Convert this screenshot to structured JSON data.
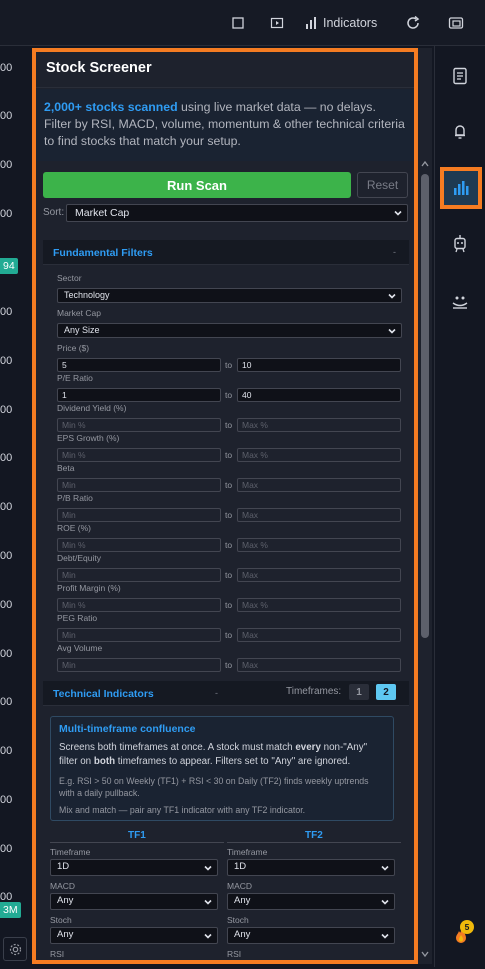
{
  "topbar": {
    "indicators_label": "Indicators"
  },
  "chart_strip": {
    "ticks": [
      "00",
      "00",
      "00",
      "00",
      "00",
      "00",
      "00",
      "00",
      "00",
      "00",
      "00",
      "00",
      "00",
      "00",
      "00",
      "00",
      "00",
      "00",
      "00"
    ],
    "badge_top": "94",
    "badge_bottom": "3M"
  },
  "screener": {
    "title": "Stock Screener",
    "intro_highlight": "2,000+ stocks scanned",
    "intro_rest": " using live market data — no delays. Filter by RSI, MACD, volume, momentum & other technical criteria to find stocks that match your setup.",
    "run_label": "Run Scan",
    "reset_label": "Reset",
    "sort_label": "Sort:",
    "sort_value": "Market Cap",
    "fundamental": {
      "title": "Fundamental Filters",
      "caret": "-",
      "sector_label": "Sector",
      "sector_value": "Technology",
      "mcap_label": "Market Cap",
      "mcap_value": "Any Size",
      "to_label": "to",
      "ranges": [
        {
          "label": "Price ($)",
          "min": "5",
          "max": "10",
          "min_ph": "",
          "max_ph": ""
        },
        {
          "label": "P/E Ratio",
          "min": "1",
          "max": "40",
          "min_ph": "",
          "max_ph": ""
        },
        {
          "label": "Dividend Yield (%)",
          "min": "",
          "max": "",
          "min_ph": "Min %",
          "max_ph": "Max %"
        },
        {
          "label": "EPS Growth (%)",
          "min": "",
          "max": "",
          "min_ph": "Min %",
          "max_ph": "Max %"
        },
        {
          "label": "Beta",
          "min": "",
          "max": "",
          "min_ph": "Min",
          "max_ph": "Max"
        },
        {
          "label": "P/B Ratio",
          "min": "",
          "max": "",
          "min_ph": "Min",
          "max_ph": "Max"
        },
        {
          "label": "ROE (%)",
          "min": "",
          "max": "",
          "min_ph": "Min %",
          "max_ph": "Max %"
        },
        {
          "label": "Debt/Equity",
          "min": "",
          "max": "",
          "min_ph": "Min",
          "max_ph": "Max"
        },
        {
          "label": "Profit Margin (%)",
          "min": "",
          "max": "",
          "min_ph": "Min %",
          "max_ph": "Max %"
        },
        {
          "label": "PEG Ratio",
          "min": "",
          "max": "",
          "min_ph": "Min",
          "max_ph": "Max"
        },
        {
          "label": "Avg Volume",
          "min": "",
          "max": "",
          "min_ph": "Min",
          "max_ph": "Max"
        }
      ]
    },
    "technical": {
      "title": "Technical Indicators",
      "caret": "-",
      "timeframes_label": "Timeframes:",
      "tf_options": [
        "1",
        "2"
      ],
      "tf_selected": "2",
      "mtf_title": "Multi-timeframe confluence",
      "mtf_p1_a": "Screens both timeframes at once. A stock must match ",
      "mtf_p1_every": "every",
      "mtf_p1_b": " non-\"Any\" filter on ",
      "mtf_p1_both": "both",
      "mtf_p1_c": " timeframes to appear. Filters set to \"Any\" are ignored.",
      "mtf_p2": "E.g. RSI > 50 on Weekly (TF1) + RSI < 30 on Daily (TF2) finds weekly uptrends with a daily pullback.",
      "mtf_p3": "Mix and match — pair any TF1 indicator with any TF2 indicator.",
      "tf1": {
        "title": "TF1",
        "timeframe_label": "Timeframe",
        "timeframe_value": "1D",
        "macd_label": "MACD",
        "macd_value": "Any",
        "stoch_label": "Stoch",
        "stoch_value": "Any",
        "rsi_label": "RSI"
      },
      "tf2": {
        "title": "TF2",
        "timeframe_label": "Timeframe",
        "timeframe_value": "1D",
        "macd_label": "MACD",
        "macd_value": "Any",
        "stoch_label": "Stoch",
        "stoch_value": "Any",
        "rsi_label": "RSI"
      }
    }
  },
  "rightbar": {
    "notification_count": "5"
  },
  "colors": {
    "accent_orange": "#f57c22",
    "accent_blue": "#2f9cf3",
    "run_green": "#3cb34a",
    "teal": "#22ab94"
  }
}
